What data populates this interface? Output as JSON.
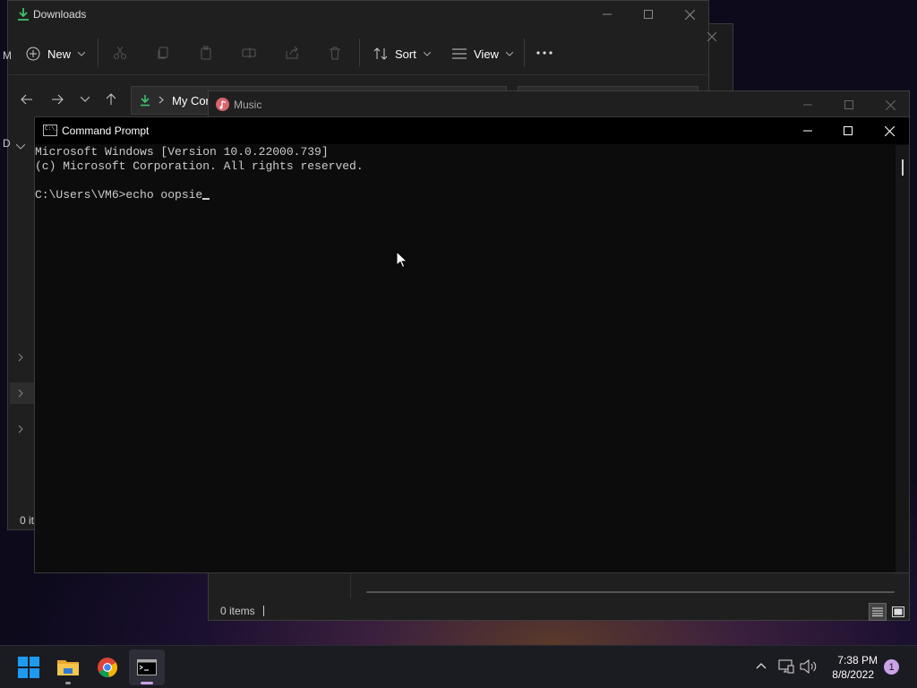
{
  "explorer": {
    "title": "Downloads",
    "toolbar": {
      "new": "New",
      "sort": "Sort",
      "view": "View"
    },
    "breadcrumb": "My Con",
    "status": "0 it",
    "left_letters": [
      "M",
      "D"
    ]
  },
  "music": {
    "title": "Music",
    "status": "0 items"
  },
  "cmd": {
    "title": "Command Prompt",
    "icon_text": "C:\\_",
    "lines": [
      "Microsoft Windows [Version 10.0.22000.739]",
      "(c) Microsoft Corporation. All rights reserved.",
      "",
      "C:\\Users\\VM6>echo oopsie"
    ]
  },
  "taskbar": {
    "time": "7:38 PM",
    "date": "8/8/2022",
    "notification_count": "1"
  },
  "colors": {
    "taskbar": "#1b1b22",
    "console_bg": "#0c0c0c",
    "console_text": "#cccccc",
    "download_green": "#3fbf6a",
    "start_blue": "#1d9bf0"
  }
}
